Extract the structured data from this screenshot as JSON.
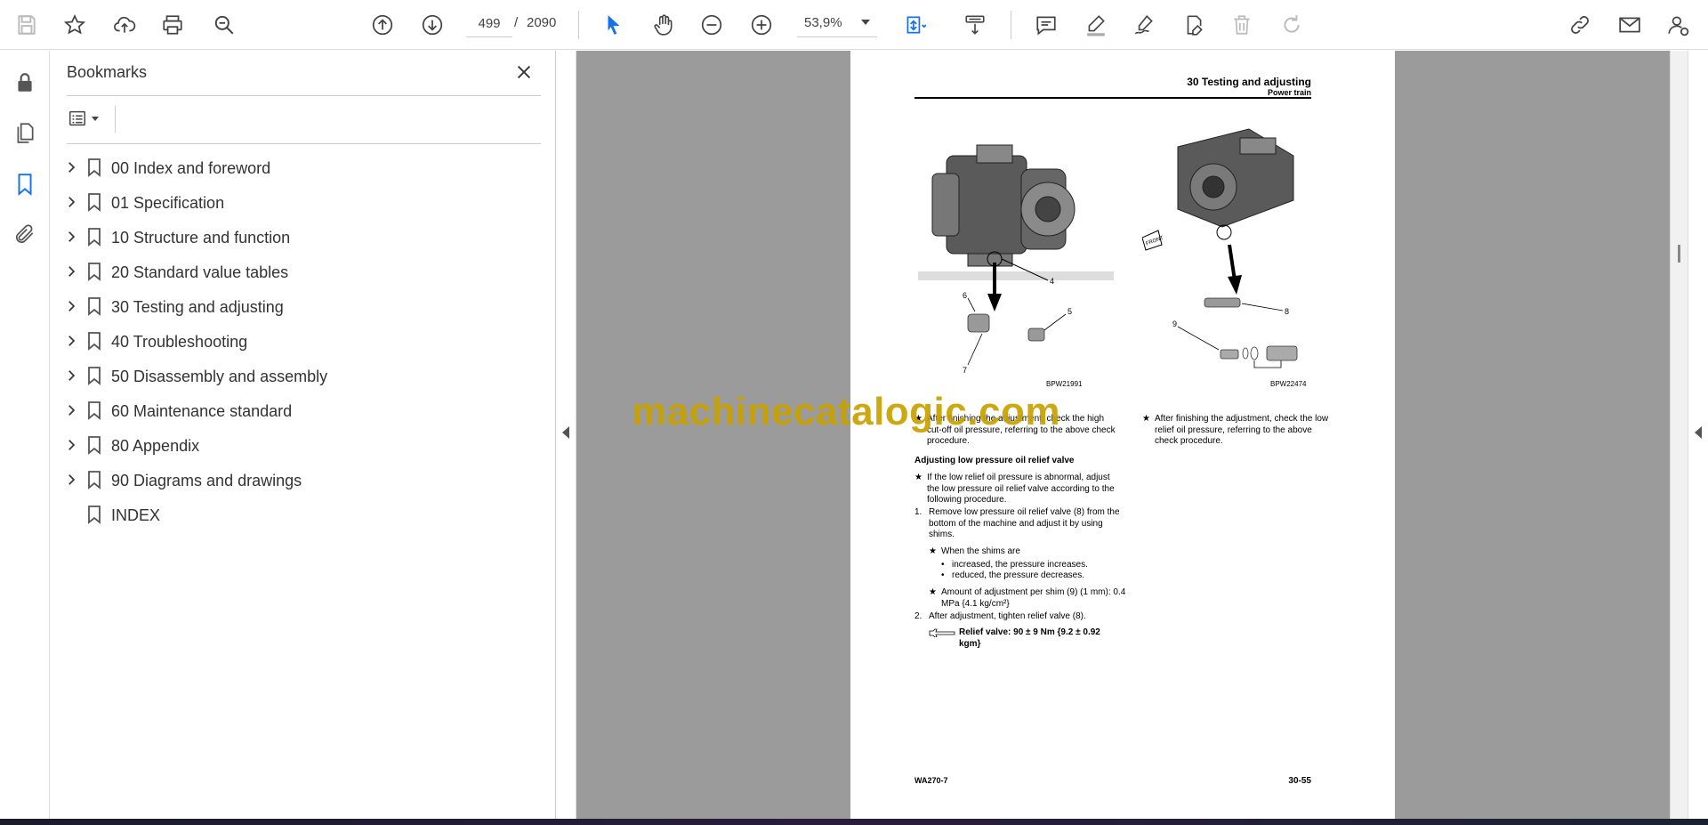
{
  "toolbar": {
    "page_current": "499",
    "page_separator": "/",
    "page_total": "2090",
    "zoom": "53,9%"
  },
  "bookmarks": {
    "title": "Bookmarks",
    "items": [
      {
        "label": "00 Index and foreword",
        "expandable": true
      },
      {
        "label": "01 Specification",
        "expandable": true
      },
      {
        "label": "10 Structure and function",
        "expandable": true
      },
      {
        "label": "20 Standard value tables",
        "expandable": true
      },
      {
        "label": "30 Testing and adjusting",
        "expandable": true
      },
      {
        "label": "40 Troubleshooting",
        "expandable": true
      },
      {
        "label": "50 Disassembly and assembly",
        "expandable": true
      },
      {
        "label": "60 Maintenance standard",
        "expandable": true
      },
      {
        "label": "80 Appendix",
        "expandable": true
      },
      {
        "label": "90 Diagrams and drawings",
        "expandable": true
      },
      {
        "label": "INDEX",
        "expandable": false
      }
    ]
  },
  "document": {
    "header_title": "30 Testing and adjusting",
    "header_sub": "Power train",
    "fig_left_code": "BPW21991",
    "fig_right_code": "BPW22474",
    "callouts_left": [
      "4",
      "6",
      "5",
      "7"
    ],
    "callouts_right": [
      "8",
      "9"
    ],
    "front_label": "FRONT",
    "left_note": "After finishing the adjustment, check the high cut-off oil pressure, referring to the above check procedure.",
    "right_note": "After finishing the adjustment, check the low relief oil pressure, referring to the above check procedure.",
    "section_heading": "Adjusting low pressure oil relief valve",
    "intro": "If the low relief oil pressure is abnormal, adjust the low pressure oil relief valve according to the following procedure.",
    "step1": "Remove low pressure oil relief valve (8) from the bottom of the machine and adjust it by using shims.",
    "shims_intro": "When the shims are",
    "bullet1": "increased, the pressure increases.",
    "bullet2": "reduced, the pressure decreases.",
    "amount": "Amount of adjustment per shim (9) (1 mm): 0.4 MPa {4.1 kg/cm²}",
    "step2": "After adjustment, tighten relief valve (8).",
    "torque": "Relief valve: 90 ± 9 Nm {9.2 ± 0.92 kgm}",
    "footer_left": "WA270-7",
    "footer_right": "30-55"
  },
  "watermark": "machinecatalogic.com",
  "colors": {
    "accent_blue": "#1473e6",
    "watermark": "#c8a100",
    "viewer_bg": "#9b9b9b"
  }
}
